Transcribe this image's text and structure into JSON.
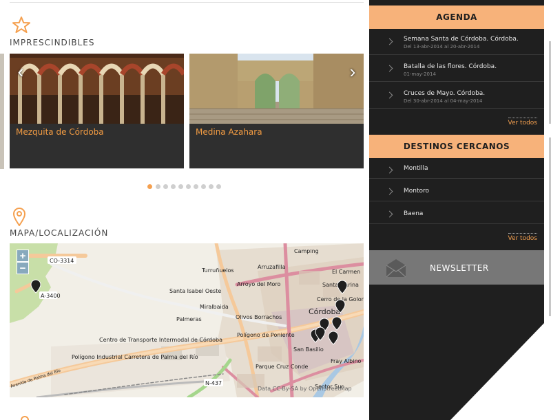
{
  "imprescindibles": {
    "title": "IMPRESCINDIBLES",
    "icon": "star-icon",
    "cards": [
      {
        "caption": "Mezquita de Córdoba"
      },
      {
        "caption": "Medina Azahara"
      }
    ],
    "prev_arrow": "‹",
    "next_arrow": "›",
    "dots_total": 10,
    "dots_active": 1
  },
  "mapa": {
    "title": "MAPA/LOCALIZACIÓN",
    "icon": "map-pin-icon",
    "zoom_in": "+",
    "zoom_out": "−",
    "labels": {
      "co3314": "CO-3314",
      "a3400": "A-3400",
      "camping": "Camping",
      "turrunuelos": "Turruñuelos",
      "arruzafilla": "Arruzafilla",
      "el_carmen": "El Carmen",
      "arroyo_moro": "Arroyo del Moro",
      "santa_marina": "Santa Marina",
      "santa_isabel": "Santa Isabel Oeste",
      "cerro_golondrina": "Cerro de la Golondrina",
      "miralbaida": "Miralbaida",
      "cordoba": "Córdoba",
      "olivos": "Olivos Borrachos",
      "palmeras": "Palmeras",
      "poligono_poniente": "Polígono de Poniente",
      "centro_transporte": "Centro de Transporte Intermodal de Córdoba",
      "poligono_industrial": "Polígono Industrial Carretera de Palma del Río",
      "san_basilio": "San Basilio",
      "fray_albino": "Fray Albino",
      "parque_cruz": "Parque Cruz Conde",
      "sector_sur": "Sector Sur",
      "avenida_palma": "Avenida de Palma del Río",
      "n437": "N-437",
      "attribution": "Data CC-By-SA by OpenStreetMap"
    }
  },
  "sidebar": {
    "agenda": {
      "header": "AGENDA",
      "items": [
        {
          "title": "Semana Santa de Córdoba. Córdoba.",
          "date": "Del 13-abr-2014 al 20-abr-2014"
        },
        {
          "title": "Batalla de las flores. Córdoba.",
          "date": "01-may-2014"
        },
        {
          "title": "Cruces de Mayo. Córdoba.",
          "date": "Del 30-abr-2014 al 04-may-2014"
        }
      ],
      "ver_todos": "Ver todos"
    },
    "destinos": {
      "header": "DESTINOS CERCANOS",
      "items": [
        {
          "title": "Montilla"
        },
        {
          "title": "Montoro"
        },
        {
          "title": "Baena"
        }
      ],
      "ver_todos": "Ver todos"
    },
    "newsletter": {
      "label": "NEWSLETTER",
      "icon": "envelope-icon"
    }
  },
  "colors": {
    "accent": "#f5a04f",
    "header_bg": "#f7b27a",
    "sidebar_bg": "#1f1f1f",
    "card_bg": "#2f2f2f",
    "newsletter_bg": "#777777"
  }
}
